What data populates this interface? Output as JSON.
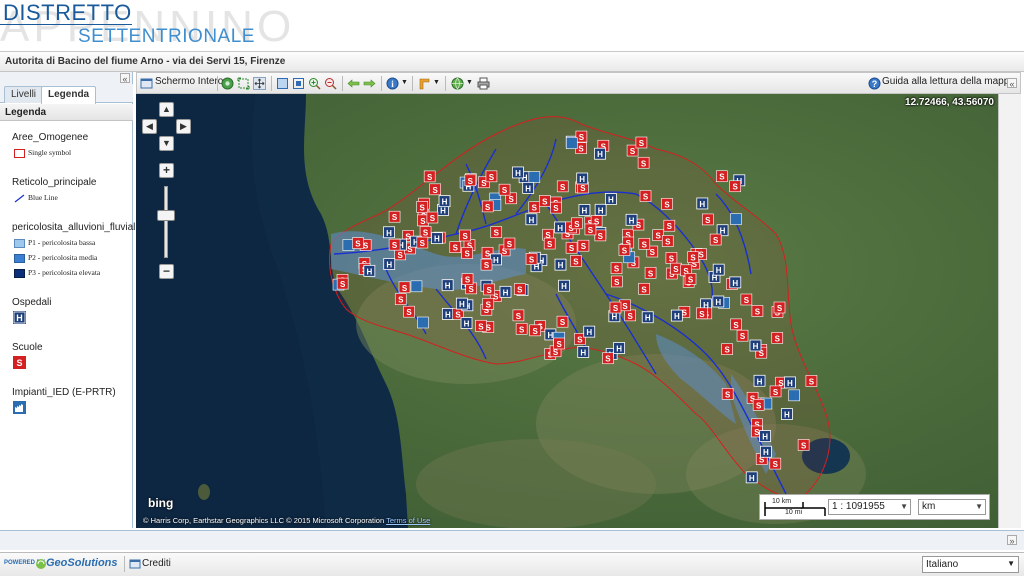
{
  "header": {
    "brand_line1": "DISTRETTO",
    "brand_bg": "APPENNINO",
    "brand_line2": "SETTENTRIONALE",
    "subtitle": "Autorita di Bacino del fiume Arno - via dei Servi 15, Firenze"
  },
  "left_panel": {
    "tabs": [
      {
        "label": "Livelli"
      },
      {
        "label": "Legenda"
      }
    ],
    "active_tab": "Legenda",
    "panel_title": "Legenda",
    "legend": {
      "aree_group": "Aree_Omogenee",
      "aree_item": "Single symbol",
      "reticolo_group": "Reticolo_principale",
      "reticolo_item": "Blue Line",
      "pericolosita_group": "pericolosita_alluvioni_fluviali",
      "p1": "P1 - pericolosita bassa",
      "p2": "P2 - pericolosita media",
      "p3": "P3 - pericolosita elevata",
      "ospedali_group": "Ospedali",
      "scuole_group": "Scuole",
      "impianti_group": "Impianti_IED (E-PRTR)"
    },
    "colors": {
      "p1": "#9ec7ec",
      "p2": "#3c7fd1",
      "p3": "#0b2f78",
      "ospedali": "#1f3f7a",
      "scuole": "#d42020",
      "aree": "#d42020"
    }
  },
  "toolbar": {
    "fullscreen_label": "Schermo Intero",
    "guide_label": "Guida alla lettura della mappa"
  },
  "map": {
    "coordinates": "12.72466, 43.56070",
    "attribution": "© Harris Corp, Earthstar Geographics LLC © 2015 Microsoft Corporation",
    "attribution_link": "Terms of Use",
    "bing_label": "bing",
    "scale_km": "10 km",
    "scale_mi": "10 mi",
    "scale_value": "1 : 1091955",
    "unit_value": "km"
  },
  "footer": {
    "powered_by": "POWERED BY",
    "geosolutions": "GeoSolutions",
    "credits": "Crediti",
    "language": "Italiano"
  }
}
